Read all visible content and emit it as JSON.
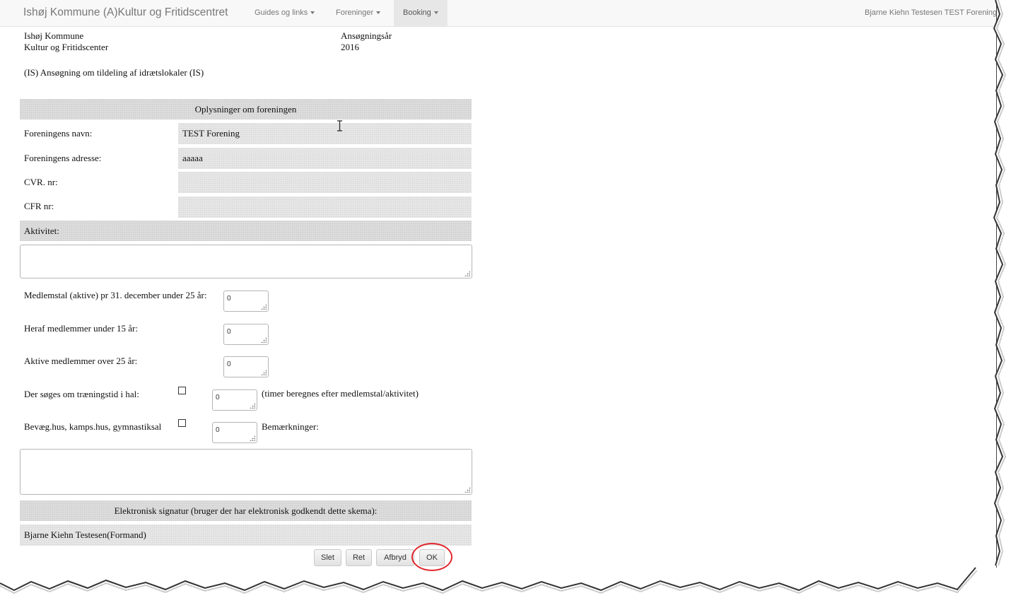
{
  "navbar": {
    "brand": "Ishøj Kommune (A)Kultur og Fritidscentret",
    "items": [
      {
        "label": "Guides og links"
      },
      {
        "label": "Foreninger"
      },
      {
        "label": "Booking"
      }
    ],
    "user": "Bjarne Kiehn Testesen TEST Forening"
  },
  "header": {
    "org_line1": "Ishøj Kommune",
    "org_line2": "Kultur og Fritidscenter",
    "year_label": "Ansøgningsår",
    "year_value": "2016",
    "form_title": "(IS) Ansøgning om tildeling af idrætslokaler (IS)"
  },
  "section_info": {
    "heading": "Oplysninger om foreningen",
    "rows": [
      {
        "label": "Foreningens navn:",
        "value": "TEST Forening"
      },
      {
        "label": "Foreningens adresse:",
        "value": "aaaaa"
      },
      {
        "label": "CVR. nr:",
        "value": ""
      },
      {
        "label": "CFR nr:",
        "value": ""
      }
    ]
  },
  "activity": {
    "label": "Aktivitet:",
    "value": ""
  },
  "members": [
    {
      "label": "Medlemstal (aktive) pr 31. december under 25 år:",
      "value": "0"
    },
    {
      "label": "Heraf medlemmer under 15 år:",
      "value": "0"
    },
    {
      "label": "Aktive medlemmer over 25 år:",
      "value": "0"
    }
  ],
  "requests": [
    {
      "label": "Der søges om træningstid i hal:",
      "checked": false,
      "value": "0",
      "note": "(timer beregnes efter medlemstal/aktivitet)"
    },
    {
      "label": "Bevæg.hus, kamps.hus, gymnastiksal",
      "checked": false,
      "value": "0",
      "note": "Bemærkninger:"
    }
  ],
  "remarks": {
    "value": ""
  },
  "signature": {
    "heading": "Elektronisk signatur (bruger der har elektronisk godkendt dette skema):",
    "value": "Bjarne Kiehn Testesen(Formand)"
  },
  "buttons": {
    "delete": "Slet",
    "edit": "Ret",
    "cancel": "Afbryd",
    "ok": "OK"
  },
  "colors": {
    "highlight_circle": "#e0282e"
  }
}
